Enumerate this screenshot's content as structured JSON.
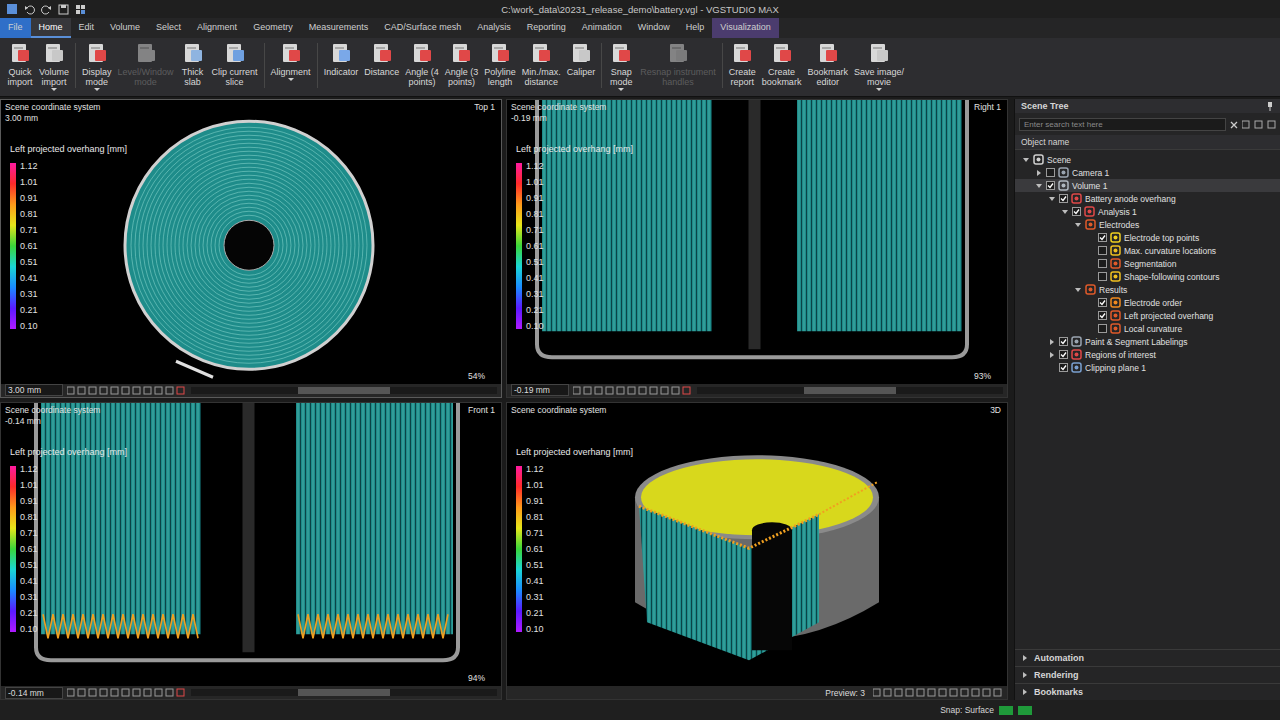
{
  "window": {
    "title": "C:\\work_data\\20231_release_demo\\battery.vgl - VGSTUDIO MAX"
  },
  "menu": [
    {
      "label": "File",
      "kind": "file",
      "selected": false
    },
    {
      "label": "Home",
      "kind": "tab",
      "selected": true
    },
    {
      "label": "Edit",
      "kind": "tab",
      "selected": false
    },
    {
      "label": "Volume",
      "kind": "tab",
      "selected": false
    },
    {
      "label": "Select",
      "kind": "tab",
      "selected": false
    },
    {
      "label": "Alignment",
      "kind": "tab",
      "selected": false
    },
    {
      "label": "Geometry",
      "kind": "tab",
      "selected": false
    },
    {
      "label": "Measurements",
      "kind": "tab",
      "selected": false
    },
    {
      "label": "CAD/Surface mesh",
      "kind": "tab",
      "selected": false
    },
    {
      "label": "Analysis",
      "kind": "tab",
      "selected": false
    },
    {
      "label": "Reporting",
      "kind": "tab",
      "selected": false
    },
    {
      "label": "Animation",
      "kind": "tab",
      "selected": false
    },
    {
      "label": "Window",
      "kind": "tab",
      "selected": false
    },
    {
      "label": "Help",
      "kind": "tab",
      "selected": false
    },
    {
      "label": "Visualization",
      "kind": "context",
      "selected": false
    }
  ],
  "ribbon": [
    {
      "label": [
        "Quick",
        "import"
      ],
      "dropdown": false,
      "disabled": false,
      "color": "#e04848",
      "group": 1
    },
    {
      "label": [
        "Volume",
        "import"
      ],
      "dropdown": true,
      "disabled": false,
      "color": "#c8c8c8",
      "group": 1
    },
    {
      "label": [
        "Display",
        "mode"
      ],
      "dropdown": true,
      "disabled": false,
      "color": "#e04848",
      "group": 2
    },
    {
      "label": [
        "Level/Window",
        "mode"
      ],
      "dropdown": false,
      "disabled": true,
      "color": "#d8d8d8",
      "group": 2
    },
    {
      "label": [
        "Thick",
        "slab"
      ],
      "dropdown": false,
      "disabled": false,
      "color": "#8fb4e0",
      "group": 2
    },
    {
      "label": [
        "Clip current",
        "slice"
      ],
      "dropdown": false,
      "disabled": false,
      "color": "#6fa0e0",
      "group": 2
    },
    {
      "label": [
        "Alignment"
      ],
      "dropdown": true,
      "disabled": false,
      "color": "#e04848",
      "group": 3
    },
    {
      "label": [
        "Indicator"
      ],
      "dropdown": false,
      "disabled": false,
      "color": "#7aa8e8",
      "group": 4
    },
    {
      "label": [
        "Distance"
      ],
      "dropdown": false,
      "disabled": false,
      "color": "#e04848",
      "group": 4
    },
    {
      "label": [
        "Angle (4",
        "points)"
      ],
      "dropdown": false,
      "disabled": false,
      "color": "#e04848",
      "group": 4
    },
    {
      "label": [
        "Angle (3",
        "points)"
      ],
      "dropdown": false,
      "disabled": false,
      "color": "#e04848",
      "group": 4
    },
    {
      "label": [
        "Polyline",
        "length"
      ],
      "dropdown": false,
      "disabled": false,
      "color": "#e04848",
      "group": 4
    },
    {
      "label": [
        "Min./max.",
        "distance"
      ],
      "dropdown": false,
      "disabled": false,
      "color": "#e04848",
      "group": 4
    },
    {
      "label": [
        "Caliper"
      ],
      "dropdown": false,
      "disabled": false,
      "color": "#c8c8c8",
      "group": 4
    },
    {
      "label": [
        "Snap",
        "mode"
      ],
      "dropdown": true,
      "disabled": false,
      "color": "#e04848",
      "group": 5
    },
    {
      "label": [
        "Resnap instrument",
        "handles"
      ],
      "dropdown": false,
      "disabled": true,
      "color": "#c8c8c8",
      "group": 5
    },
    {
      "label": [
        "Create",
        "report"
      ],
      "dropdown": false,
      "disabled": false,
      "color": "#e04848",
      "group": 6
    },
    {
      "label": [
        "Create",
        "bookmark"
      ],
      "dropdown": false,
      "disabled": false,
      "color": "#e04848",
      "group": 6
    },
    {
      "label": [
        "Bookmark",
        "editor"
      ],
      "dropdown": false,
      "disabled": false,
      "color": "#e04848",
      "group": 6
    },
    {
      "label": [
        "Save image/",
        "movie"
      ],
      "dropdown": true,
      "disabled": false,
      "color": "#c8c8c8",
      "group": 6
    }
  ],
  "legend": {
    "title": "Left projected overhang [mm]",
    "ticks": [
      "1.12",
      "1.01",
      "0.91",
      "0.81",
      "0.71",
      "0.61",
      "0.51",
      "0.41",
      "0.31",
      "0.21",
      "0.10"
    ]
  },
  "views": [
    {
      "kind": "top",
      "header": "Scene coordinate system",
      "name": "Top 1",
      "value": "3.00 mm",
      "zoom": "54%",
      "field": "3.00 mm",
      "selected": true
    },
    {
      "kind": "right",
      "header": "Scene coordinate system",
      "name": "Right 1",
      "value": "-0.19 mm",
      "zoom": "93%",
      "field": "-0.19 mm",
      "selected": false
    },
    {
      "kind": "front",
      "header": "Scene coordinate system",
      "name": "Front 1",
      "value": "-0.14 mm",
      "zoom": "94%",
      "field": "-0.14 mm",
      "selected": false
    },
    {
      "kind": "3d",
      "header": "Scene coordinate system",
      "name": "3D",
      "value": "",
      "zoom": "",
      "field": "Preview: 3",
      "selected": false
    }
  ],
  "sceneTree": {
    "title": "Scene Tree",
    "search": {
      "placeholder": "Enter search text here"
    },
    "column": "Object name",
    "items": [
      {
        "label": "Scene",
        "level": 0,
        "kind": "plain",
        "expanded": true,
        "selected": false,
        "color": "#d0d0d0"
      },
      {
        "label": "Camera 1",
        "level": 1,
        "kind": "check",
        "checked": false,
        "expanded": false,
        "selected": false,
        "color": "#9aa4b0"
      },
      {
        "label": "Volume 1",
        "level": 1,
        "kind": "check",
        "checked": true,
        "expanded": true,
        "selected": true,
        "color": "#b0b8c0"
      },
      {
        "label": "Battery anode overhang",
        "level": 2,
        "kind": "check",
        "checked": true,
        "expanded": true,
        "selected": false,
        "color": "#e04848"
      },
      {
        "label": "Analysis 1",
        "level": 3,
        "kind": "check",
        "checked": true,
        "expanded": true,
        "selected": false,
        "color": "#e04848"
      },
      {
        "label": "Electrodes",
        "level": 4,
        "kind": "plain",
        "expanded": true,
        "selected": false,
        "color": "#e05a2a"
      },
      {
        "label": "Electrode top points",
        "level": 5,
        "kind": "check",
        "checked": true,
        "selected": false,
        "color": "#f0d020"
      },
      {
        "label": "Max. curvature locations",
        "level": 5,
        "kind": "check",
        "checked": false,
        "selected": false,
        "color": "#f0c020"
      },
      {
        "label": "Segmentation",
        "level": 5,
        "kind": "check",
        "checked": false,
        "selected": false,
        "color": "#e05a2a"
      },
      {
        "label": "Shape-following contours",
        "level": 5,
        "kind": "check",
        "checked": false,
        "selected": false,
        "color": "#f0c020"
      },
      {
        "label": "Results",
        "level": 4,
        "kind": "plain",
        "expanded": true,
        "selected": false,
        "color": "#e05a2a"
      },
      {
        "label": "Electrode order",
        "level": 5,
        "kind": "check",
        "checked": true,
        "selected": false,
        "color": "#f08a20"
      },
      {
        "label": "Left projected overhang",
        "level": 5,
        "kind": "check",
        "checked": true,
        "selected": false,
        "color": "#e05a2a"
      },
      {
        "label": "Local curvature",
        "level": 5,
        "kind": "check",
        "checked": false,
        "selected": false,
        "color": "#e05a2a"
      },
      {
        "label": "Paint & Segment Labelings",
        "level": 2,
        "kind": "check",
        "checked": true,
        "expanded": false,
        "selected": false,
        "color": "#9aa4b0"
      },
      {
        "label": "Regions of interest",
        "level": 2,
        "kind": "check",
        "checked": true,
        "expanded": false,
        "selected": false,
        "color": "#e04848"
      },
      {
        "label": "Clipping plane 1",
        "level": 2,
        "kind": "check",
        "checked": true,
        "selected": false,
        "color": "#7aa0d0"
      }
    ],
    "sections": [
      {
        "label": "Automation",
        "expanded": false
      },
      {
        "label": "Rendering",
        "expanded": false
      },
      {
        "label": "Bookmarks",
        "expanded": false
      }
    ]
  },
  "statusBar": {
    "snap": "Snap: Surface",
    "indicators": [
      {
        "color": "#1f9a3a"
      },
      {
        "color": "#1f9a3a"
      }
    ]
  }
}
